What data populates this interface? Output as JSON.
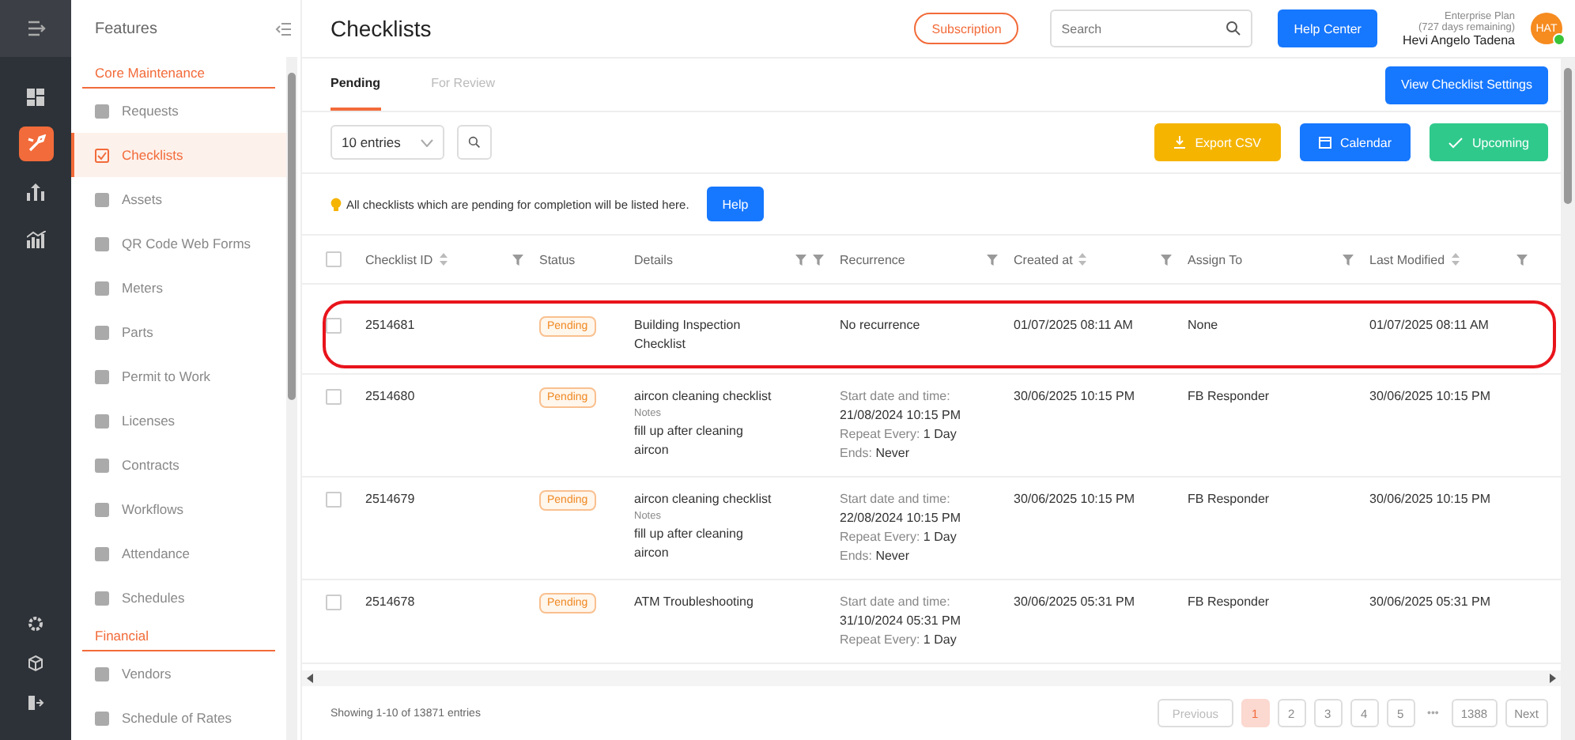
{
  "sidebar": {
    "title": "Features",
    "sections": [
      {
        "title": "Core Maintenance",
        "items": [
          {
            "label": "Requests",
            "selected": false
          },
          {
            "label": "Checklists",
            "selected": true
          },
          {
            "label": "Assets",
            "selected": false
          },
          {
            "label": "QR Code Web Forms",
            "selected": false
          },
          {
            "label": "Meters",
            "selected": false
          },
          {
            "label": "Parts",
            "selected": false
          },
          {
            "label": "Permit to Work",
            "selected": false
          },
          {
            "label": "Licenses",
            "selected": false
          },
          {
            "label": "Contracts",
            "selected": false
          },
          {
            "label": "Workflows",
            "selected": false
          },
          {
            "label": "Attendance",
            "selected": false
          },
          {
            "label": "Schedules",
            "selected": false
          }
        ]
      },
      {
        "title": "Financial",
        "items": [
          {
            "label": "Vendors",
            "selected": false
          },
          {
            "label": "Schedule of Rates",
            "selected": false
          }
        ]
      }
    ]
  },
  "rail": [
    {
      "selected": false
    },
    {
      "selected": true
    },
    {
      "selected": false
    },
    {
      "selected": false
    }
  ],
  "header": {
    "title": "Checklists",
    "subscription": "Subscription",
    "search": {
      "placeholder": "Search"
    },
    "help_center": "Help Center",
    "plan": "Enterprise Plan",
    "remaining": "(727 days remaining)",
    "user": "Hevi Angelo Tadena",
    "avatar": "HAT",
    "online": true
  },
  "tabs": [
    {
      "label": "Pending",
      "selected": true
    },
    {
      "label": "For Review",
      "selected": false
    }
  ],
  "settings_button": "View Checklist Settings",
  "entries_select": "10 entries",
  "actions": [
    {
      "label": "Export CSV",
      "kind": "export"
    },
    {
      "label": "Calendar",
      "kind": "calendar"
    },
    {
      "label": "Upcoming",
      "kind": "upcoming"
    }
  ],
  "notice": {
    "text": "All checklists which are pending for completion will be listed here.",
    "button": "Help"
  },
  "table": {
    "select_all": {
      "checked": false
    },
    "columns": [
      {
        "label": "Checklist ID",
        "sortable": true
      },
      {
        "label": "Status",
        "sortable": false
      },
      {
        "label": "Details",
        "sortable": false
      },
      {
        "label": "Recurrence",
        "sortable": false
      },
      {
        "label": "Created at",
        "sortable": true
      },
      {
        "label": "Assign To",
        "sortable": false
      },
      {
        "label": "Last Modified",
        "sortable": true
      }
    ],
    "rows": [
      {
        "id": "2514681",
        "status": "Pending",
        "details": {
          "title": "Building Inspection Checklist"
        },
        "recurrence": {
          "kind": "none",
          "text": "No recurrence"
        },
        "created": "01/07/2025 08:11 AM",
        "assignee": "None",
        "modified": "01/07/2025 08:11 AM",
        "circled": true,
        "checked": false
      },
      {
        "id": "2514680",
        "status": "Pending",
        "details": {
          "title": "aircon cleaning checklist",
          "notes_label": "Notes",
          "notes": "fill up after cleaning aircon"
        },
        "recurrence": {
          "kind": "repeat",
          "start_label": "Start date and time:",
          "start": "21/08/2024 10:15 PM",
          "repeat_label": "Repeat Every:",
          "repeat": "1 Day",
          "ends_label": "Ends:",
          "ends": "Never"
        },
        "created": "30/06/2025 10:15 PM",
        "assignee": "FB Responder",
        "modified": "30/06/2025 10:15 PM",
        "circled": false,
        "checked": false
      },
      {
        "id": "2514679",
        "status": "Pending",
        "details": {
          "title": "aircon cleaning checklist",
          "notes_label": "Notes",
          "notes": "fill up after cleaning aircon"
        },
        "recurrence": {
          "kind": "repeat",
          "start_label": "Start date and time:",
          "start": "22/08/2024 10:15 PM",
          "repeat_label": "Repeat Every:",
          "repeat": "1 Day",
          "ends_label": "Ends:",
          "ends": "Never"
        },
        "created": "30/06/2025 10:15 PM",
        "assignee": "FB Responder",
        "modified": "30/06/2025 10:15 PM",
        "circled": false,
        "checked": false
      },
      {
        "id": "2514678",
        "status": "Pending",
        "details": {
          "title": "ATM Troubleshooting"
        },
        "recurrence": {
          "kind": "repeat",
          "start_label": "Start date and time:",
          "start": "31/10/2024 05:31 PM",
          "repeat_label": "Repeat Every:",
          "repeat": "1 Day"
        },
        "created": "30/06/2025 05:31 PM",
        "assignee": "FB Responder",
        "modified": "30/06/2025 05:31 PM",
        "circled": false,
        "checked": false
      }
    ]
  },
  "footer": {
    "summary": "Showing 1-10 of 13871 entries",
    "previous": "Previous",
    "next": "Next",
    "ellipsis": "•••",
    "pages": [
      {
        "label": "1",
        "selected": true
      },
      {
        "label": "2",
        "selected": false
      },
      {
        "label": "3",
        "selected": false
      },
      {
        "label": "4",
        "selected": false
      },
      {
        "label": "5",
        "selected": false
      },
      {
        "label": "1388",
        "selected": false
      }
    ]
  }
}
